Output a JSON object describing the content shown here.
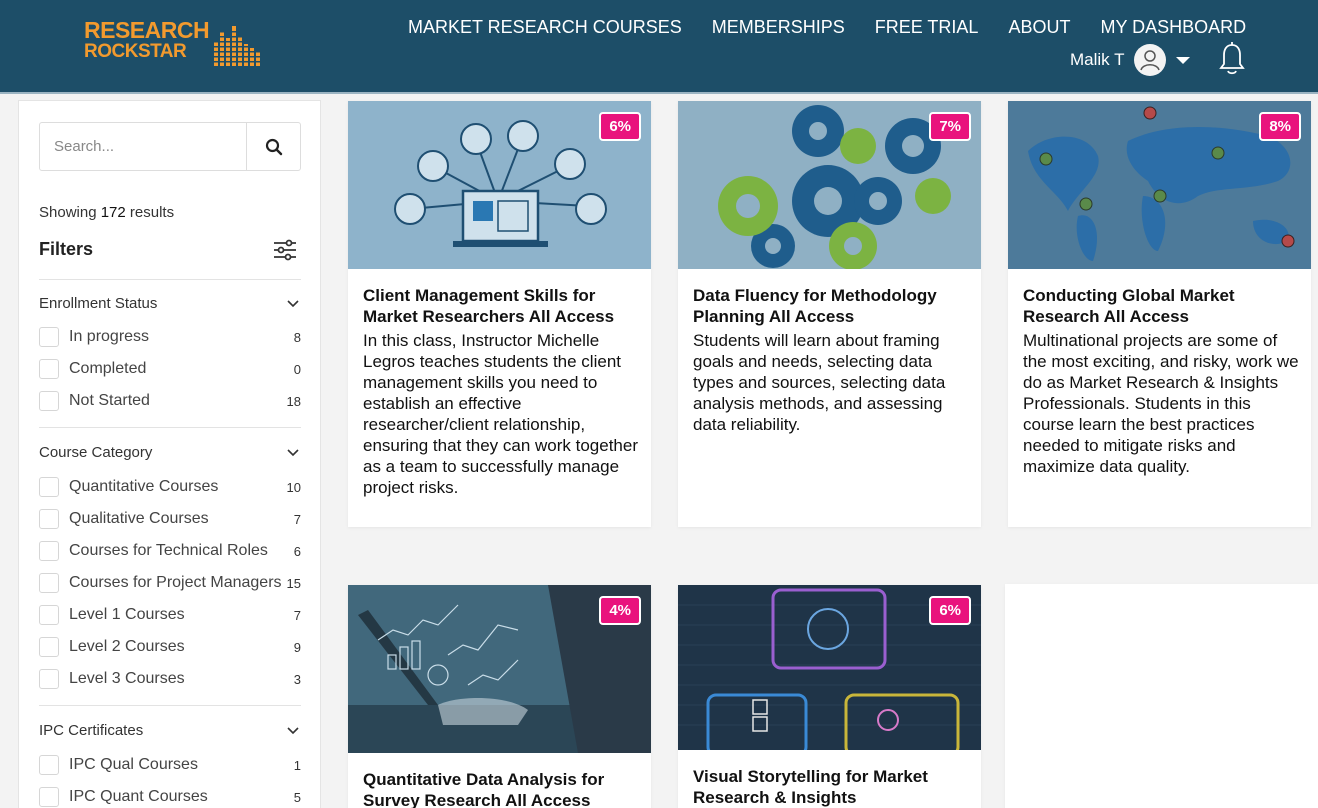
{
  "brand": {
    "line1": "RESEARCH",
    "line2": "ROCKSTAR",
    "color": "#f29a2e",
    "header_bg": "#1d4e68"
  },
  "nav": {
    "items": [
      "MARKET RESEARCH COURSES",
      "MEMBERSHIPS",
      "FREE TRIAL",
      "ABOUT",
      "MY DASHBOARD"
    ]
  },
  "user": {
    "name": "Malik T",
    "avatar_icon": "user-avatar-icon",
    "notification_icon": "bell-icon"
  },
  "sidebar": {
    "search_placeholder": "Search...",
    "showing_prefix": "Showing",
    "showing_count": "172",
    "showing_suffix": "results",
    "filters_title": "Filters",
    "groups": [
      {
        "title": "Enrollment Status",
        "options": [
          {
            "label": "In progress",
            "count": "8"
          },
          {
            "label": "Completed",
            "count": "0"
          },
          {
            "label": "Not Started",
            "count": "18"
          }
        ]
      },
      {
        "title": "Course Category",
        "options": [
          {
            "label": "Quantitative Courses",
            "count": "10"
          },
          {
            "label": "Qualitative Courses",
            "count": "7"
          },
          {
            "label": "Courses for Technical Roles",
            "count": "6"
          },
          {
            "label": "Courses for Project Managers",
            "count": "15"
          },
          {
            "label": "Level 1 Courses",
            "count": "7"
          },
          {
            "label": "Level 2 Courses",
            "count": "9"
          },
          {
            "label": "Level 3 Courses",
            "count": "3"
          }
        ]
      },
      {
        "title": "IPC Certificates",
        "options": [
          {
            "label": "IPC Qual Courses",
            "count": "1"
          },
          {
            "label": "IPC Quant Courses",
            "count": "5"
          }
        ]
      }
    ]
  },
  "courses": [
    {
      "badge": "6%",
      "title": "Client Management Skills for Market Researchers All Access",
      "description": "In this class, Instructor Michelle Legros teaches students the client management skills you need to establish an effective researcher/client relationship, ensuring that they can work together as a team to successfully manage project risks."
    },
    {
      "badge": "7%",
      "title": "Data Fluency for Methodology Planning All Access",
      "description": "Students will learn about framing goals and needs, selecting data types and sources, selecting data analysis methods, and assessing data reliability."
    },
    {
      "badge": "8%",
      "title": "Conducting Global Market Research All Access",
      "description": "Multinational projects are some of the most exciting, and risky, work we do as Market Research & Insights Professionals. Students in this course learn the best practices needed to mitigate risks and maximize data quality."
    },
    {
      "badge": "4%",
      "title": "Quantitative Data Analysis for Survey Research All Access",
      "description": ""
    },
    {
      "badge": "6%",
      "title": "Visual Storytelling for Market Research & Insights",
      "description": ""
    }
  ],
  "colors": {
    "badge": "#e9137d",
    "accent_gear_blue": "#1f5d8c",
    "accent_gear_green": "#7cb342"
  }
}
